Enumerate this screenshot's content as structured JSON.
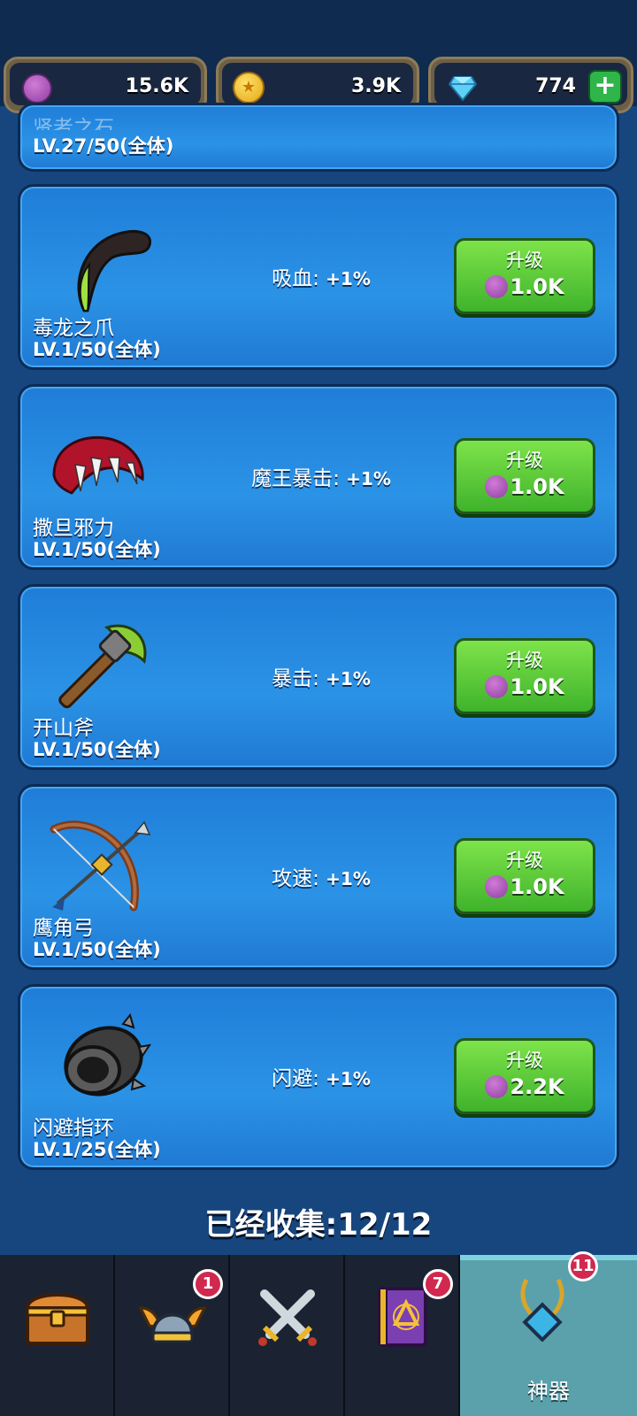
{
  "currencies": [
    {
      "icon": "purple-gem-coin-icon",
      "value": "15.6K"
    },
    {
      "icon": "gold-coin-icon",
      "value": "3.9K"
    },
    {
      "icon": "diamond-icon",
      "value": "774",
      "add": "+"
    }
  ],
  "partial_card": {
    "name": "贤者之石",
    "level": "LV.27/50(全体)"
  },
  "artifacts": [
    {
      "name": "毒龙之爪",
      "level": "LV.1/50(全体)",
      "effect_label": "吸血:",
      "effect_value": "+1%",
      "upgrade_label": "升级",
      "cost": "1.0K",
      "icon": "claw-icon"
    },
    {
      "name": "撒旦邪力",
      "level": "LV.1/50(全体)",
      "effect_label": "魔王暴击:",
      "effect_value": "+1%",
      "upgrade_label": "升级",
      "cost": "1.0K",
      "icon": "demon-jaw-icon"
    },
    {
      "name": "开山斧",
      "level": "LV.1/50(全体)",
      "effect_label": "暴击:",
      "effect_value": "+1%",
      "upgrade_label": "升级",
      "cost": "1.0K",
      "icon": "axe-icon"
    },
    {
      "name": "鹰角弓",
      "level": "LV.1/50(全体)",
      "effect_label": "攻速:",
      "effect_value": "+1%",
      "upgrade_label": "升级",
      "cost": "1.0K",
      "icon": "bow-icon"
    },
    {
      "name": "闪避指环",
      "level": "LV.1/25(全体)",
      "effect_label": "闪避:",
      "effect_value": "+1%",
      "upgrade_label": "升级",
      "cost": "2.2K",
      "icon": "ring-icon"
    }
  ],
  "collected": "已经收集:12/12",
  "nav": {
    "tabs": [
      {
        "icon": "treasure-chest-icon",
        "badge": "",
        "label": ""
      },
      {
        "icon": "winged-helmet-icon",
        "badge": "1",
        "label": ""
      },
      {
        "icon": "crossed-swords-icon",
        "badge": "",
        "label": ""
      },
      {
        "icon": "spellbook-icon",
        "badge": "7",
        "label": ""
      },
      {
        "icon": "amulet-icon",
        "badge": "11",
        "label": "神器"
      }
    ]
  },
  "colors": {
    "accent_green": "#3fb32c",
    "card_blue": "#2b93e6",
    "badge_red": "#d0284f",
    "active_tab": "#5aa1ac"
  }
}
